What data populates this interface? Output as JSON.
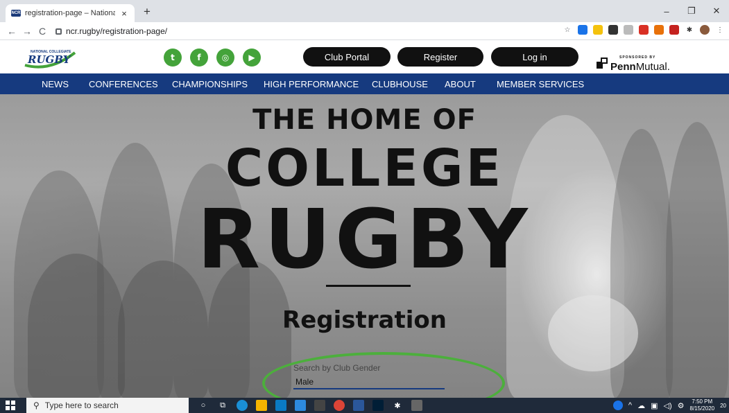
{
  "browser": {
    "tab_title": "registration-page – National Coll",
    "favicon_text": "NCR",
    "tab_close": "×",
    "new_tab": "+",
    "window_controls": [
      "–",
      "❐",
      "✕"
    ],
    "url": "ncr.rugby/registration-page/",
    "nav": [
      "←",
      "→",
      "C"
    ]
  },
  "site": {
    "logo_top": "NATIONAL COLLEGIATE",
    "logo_main": "RUGBY",
    "social": [
      "twitter-icon",
      "facebook-icon",
      "instagram-icon",
      "youtube-icon"
    ],
    "social_glyphs": [
      "t",
      "f",
      "◎",
      "▶"
    ],
    "buttons": {
      "club_portal": "Club Portal",
      "register": "Register",
      "login": "Log in"
    },
    "sponsor_small": "SPONSORED BY",
    "sponsor_brand_bold": "Penn",
    "sponsor_brand_light": "Mutual."
  },
  "mainnav": [
    "NEWS",
    "CONFERENCES",
    "CHAMPIONSHIPS",
    "HIGH PERFORMANCE",
    "CLUBHOUSE",
    "ABOUT",
    "MEMBER SERVICES"
  ],
  "hero": {
    "line1": "THE HOME OF",
    "line2": "COLLEGE",
    "line3": "RUGBY",
    "heading": "Registration",
    "search_label": "Search by Club Gender",
    "search_value": "Male"
  },
  "taskbar": {
    "search_placeholder": "Type here to search",
    "time": "7:50 PM",
    "date": "8/15/2020",
    "notif_count": "20"
  },
  "colors": {
    "nav_blue": "#163a7f",
    "social_green": "#44a33a",
    "highlight_green": "#4caf3c"
  }
}
